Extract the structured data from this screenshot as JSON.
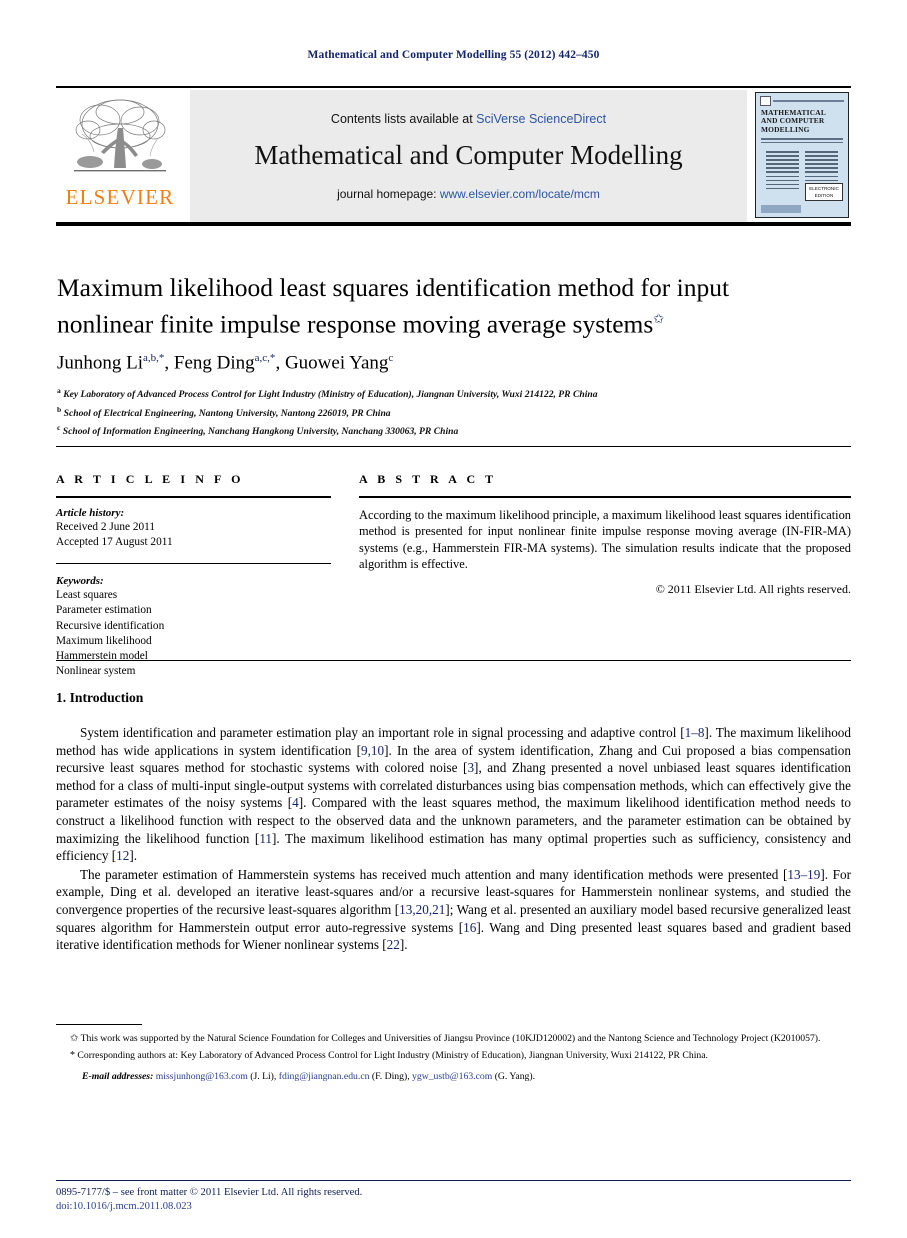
{
  "running_head": "Mathematical and Computer Modelling 55 (2012) 442–450",
  "masthead": {
    "contents_prefix": "Contents lists available at ",
    "contents_link": "SciVerse ScienceDirect",
    "journal_title": "Mathematical and Computer Modelling",
    "homepage_prefix": "journal homepage: ",
    "homepage_link": "www.elsevier.com/locate/mcm",
    "publisher": "ELSEVIER",
    "cover": {
      "title_line1": "MATHEMATICAL",
      "title_line2": "AND COMPUTER",
      "title_line3": "MODELLING",
      "badge": "ELECTRONIC EDITION"
    }
  },
  "article": {
    "title": "Maximum likelihood least squares identification method for input nonlinear finite impulse response moving average systems",
    "title_marker": "✩",
    "authors": [
      {
        "name": "Junhong Li",
        "sup": "a,b,*"
      },
      {
        "name": "Feng Ding",
        "sup": "a,c,*"
      },
      {
        "name": "Guowei Yang",
        "sup": "c"
      }
    ],
    "affiliations": [
      {
        "mark": "a",
        "text": "Key Laboratory of Advanced Process Control for Light Industry (Ministry of Education), Jiangnan University, Wuxi 214122, PR China"
      },
      {
        "mark": "b",
        "text": "School of Electrical Engineering, Nantong University, Nantong 226019, PR China"
      },
      {
        "mark": "c",
        "text": "School of Information Engineering, Nanchang Hangkong University, Nanchang 330063, PR China"
      }
    ]
  },
  "info": {
    "heading": "A R T I C L E    I N F O",
    "history_label": "Article history:",
    "history": [
      "Received 2 June 2011",
      "Accepted 17 August 2011"
    ],
    "keywords_label": "Keywords:",
    "keywords": [
      "Least squares",
      "Parameter estimation",
      "Recursive identification",
      "Maximum likelihood",
      "Hammerstein model",
      "Nonlinear system"
    ]
  },
  "abstract": {
    "heading": "A B S T R A C T",
    "text": "According to the maximum likelihood principle, a maximum likelihood least squares identification method is presented for input nonlinear finite impulse response moving average (IN-FIR-MA) systems (e.g., Hammerstein FIR-MA systems). The simulation results indicate that the proposed algorithm is effective.",
    "copyright": "© 2011 Elsevier Ltd. All rights reserved."
  },
  "body": {
    "section_heading": "1.  Introduction",
    "paragraph1_parts": [
      "System identification and parameter estimation play an important role in signal processing and adaptive control [",
      "1–8",
      "]. The maximum likelihood method has wide applications in system identification [",
      "9,10",
      "]. In the area of system identification, Zhang and Cui proposed a bias compensation recursive least squares method for stochastic systems with colored noise [",
      "3",
      "], and Zhang presented a novel unbiased least squares identification method for a class of multi-input single-output systems with correlated disturbances using bias compensation methods, which can effectively give the parameter estimates of the noisy systems [",
      "4",
      "]. Compared with the least squares method, the maximum likelihood identification method needs to construct a likelihood function with respect to the observed data and the unknown parameters, and the parameter estimation can be obtained by maximizing the likelihood function [",
      "11",
      "]. The maximum likelihood estimation has many optimal properties such as sufficiency, consistency and efficiency [",
      "12",
      "]."
    ],
    "paragraph2_parts": [
      "The parameter estimation of Hammerstein systems has received much attention and many identification methods were presented [",
      "13–19",
      "]. For example, Ding et al. developed an iterative least-squares and/or a recursive least-squares for Hammerstein nonlinear systems, and studied the convergence properties of the recursive least-squares algorithm [",
      "13,20,21",
      "]; Wang et al. presented an auxiliary model based recursive generalized least squares algorithm for Hammerstein output error auto-regressive systems [",
      "16",
      "]. Wang and Ding presented least squares based and gradient based iterative identification methods for Wiener nonlinear systems [",
      "22",
      "]."
    ]
  },
  "footnotes": {
    "funding_mark": "✩",
    "funding": "This work was supported by the Natural Science Foundation for Colleges and Universities of Jiangsu Province (10KJD120002) and the Nantong Science and Technology Project (K2010057).",
    "corresponding_mark": "*",
    "corresponding": "Corresponding authors at: Key Laboratory of Advanced Process Control for Light Industry (Ministry of Education), Jiangnan University, Wuxi 214122, PR China.",
    "email_label": "E-mail addresses:",
    "emails": [
      {
        "address": "missjunhong@163.com",
        "who": "(J. Li)"
      },
      {
        "address": "fding@jiangnan.edu.cn",
        "who": "(F. Ding)"
      },
      {
        "address": "ygw_ustb@163.com",
        "who": "(G. Yang)"
      }
    ]
  },
  "imprint": {
    "issn_line": "0895-7177/$ – see front matter © 2011 Elsevier Ltd. All rights reserved.",
    "doi_line": "doi:10.1016/j.mcm.2011.08.023"
  },
  "colors": {
    "link": "#2a55a3",
    "navy": "#13266b",
    "elsevier_orange": "#f07f13",
    "masthead_bg": "#ebebeb"
  }
}
